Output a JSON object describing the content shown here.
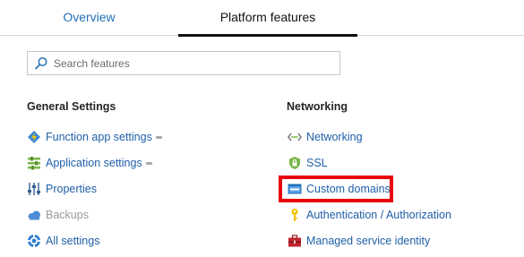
{
  "tabs": [
    {
      "label": "Overview",
      "active": false
    },
    {
      "label": "Platform features",
      "active": true
    }
  ],
  "search": {
    "placeholder": "Search features",
    "value": ""
  },
  "sections": {
    "general": {
      "title": "General Settings",
      "items": [
        {
          "label": "Function app settings",
          "icon": "function-app-icon",
          "pinned": true
        },
        {
          "label": "Application settings",
          "icon": "app-settings-icon",
          "pinned": true
        },
        {
          "label": "Properties",
          "icon": "properties-icon"
        },
        {
          "label": "Backups",
          "icon": "backups-cloud-icon",
          "disabled": true
        },
        {
          "label": "All settings",
          "icon": "all-settings-icon"
        }
      ]
    },
    "networking": {
      "title": "Networking",
      "items": [
        {
          "label": "Networking",
          "icon": "networking-icon"
        },
        {
          "label": "SSL",
          "icon": "ssl-shield-icon"
        },
        {
          "label": "Custom domains",
          "icon": "www-icon",
          "highlighted": true
        },
        {
          "label": "Authentication / Authorization",
          "icon": "key-icon"
        },
        {
          "label": "Managed service identity",
          "icon": "toolbox-icon"
        }
      ]
    }
  },
  "colors": {
    "link": "#1f5fa8",
    "highlight": "#e8000b",
    "tab_active": "#111111"
  }
}
